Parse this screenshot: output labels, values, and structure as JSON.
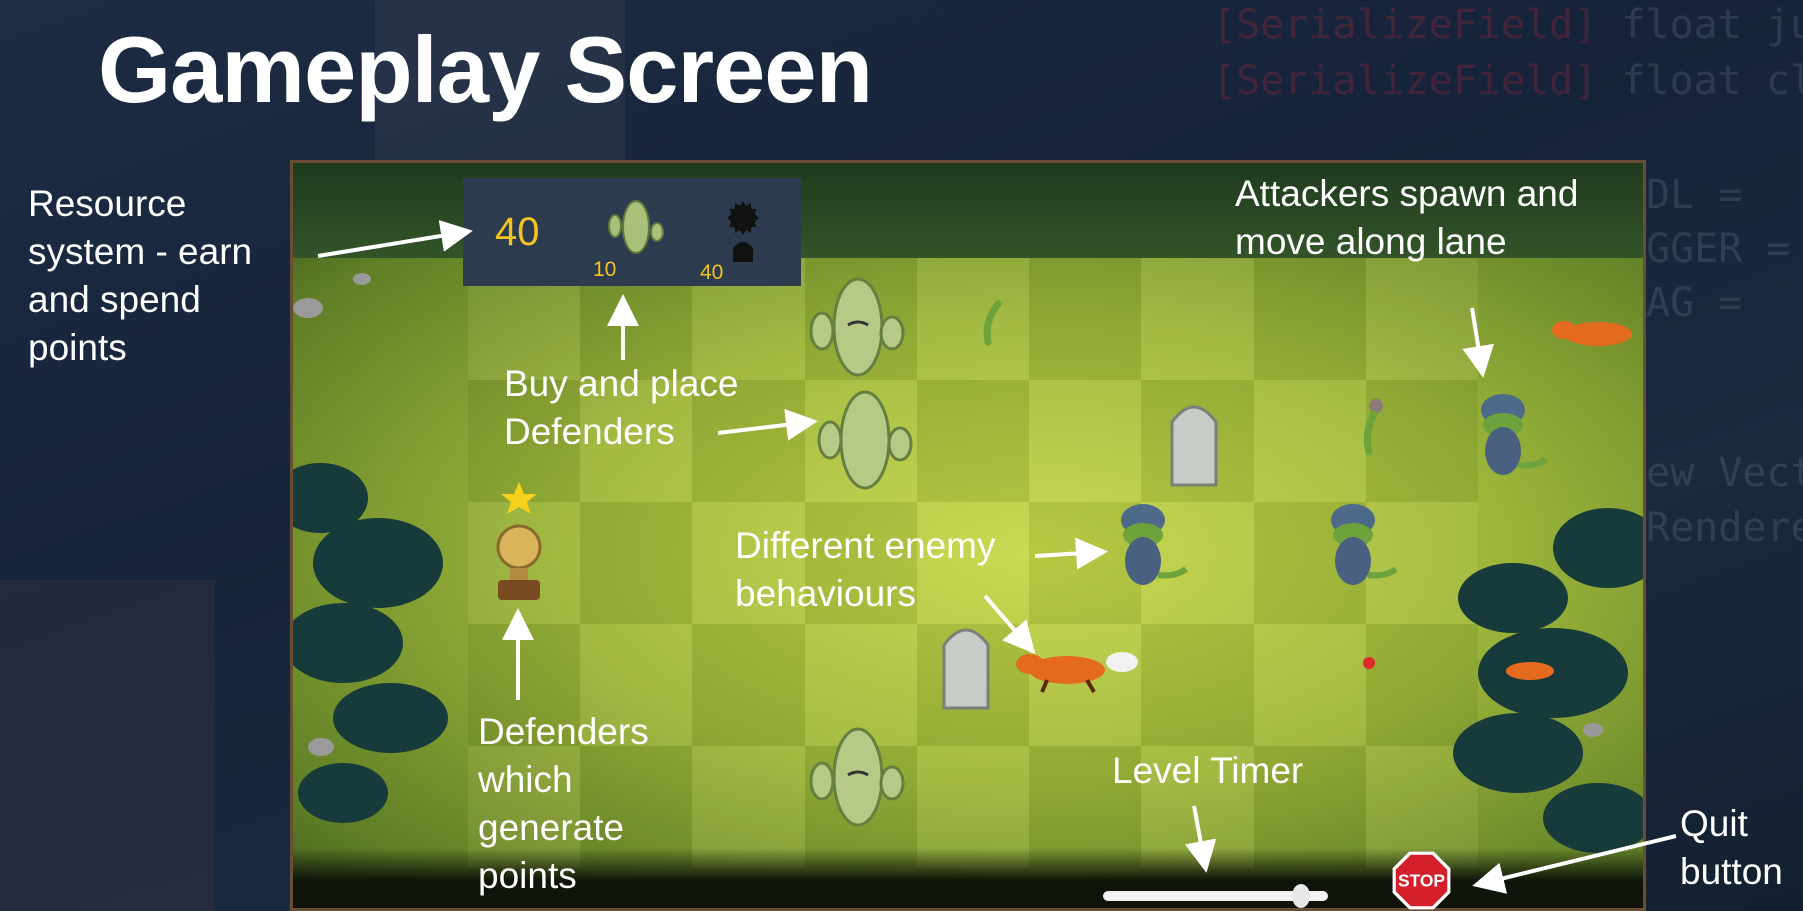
{
  "slide": {
    "title": "Gameplay Screen"
  },
  "background_code": {
    "line1_attr": "[SerializeField]",
    "line1_rest": "float jumpSp",
    "line2_attr": "[SerializeField]",
    "line2_rest": "float climbS",
    "frag1": "DL =",
    "frag2": "GGER =",
    "frag3": "AG =",
    "frag4": "ew Vecto",
    "frag5": "Renderer"
  },
  "annotations": {
    "resource_system": "Resource system - earn and spend points",
    "buy_place": "Buy and place Defenders",
    "enemy_behaviours": "Different enemy behaviours",
    "generators": "Defenders which generate points",
    "attackers": "Attackers spawn and move along lane",
    "level_timer": "Level Timer",
    "quit": "Quit button"
  },
  "game": {
    "resources": "40",
    "defender_costs": [
      "10",
      "40"
    ],
    "defender_icons": [
      "cactus-icon",
      "gravestone-icon"
    ],
    "stop_label": "STOP",
    "level_progress": 0.88,
    "colors": {
      "resource_text": "#f2c41e",
      "panel": "#2c3b4e",
      "stop": "#d3202a",
      "frame": "#6a4e34"
    }
  }
}
